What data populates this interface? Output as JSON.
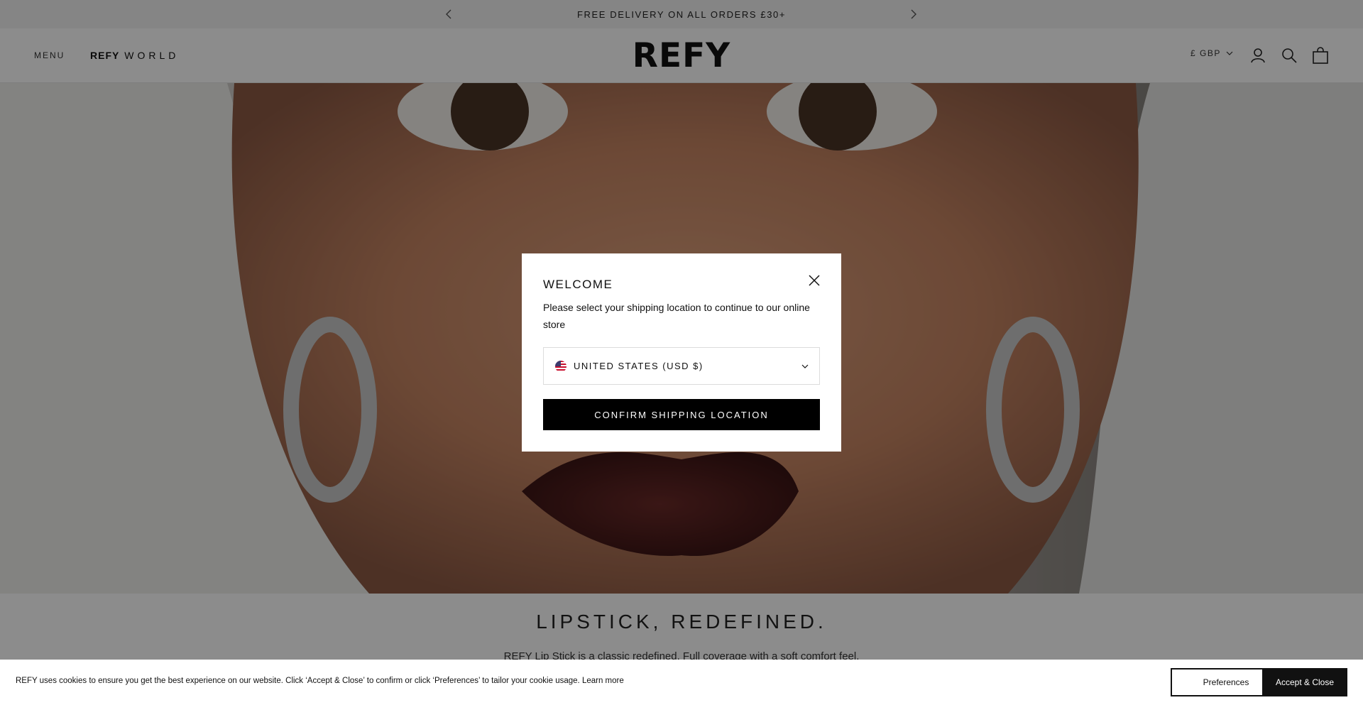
{
  "announcement": {
    "text": "FREE DELIVERY ON ALL ORDERS £30+"
  },
  "header": {
    "menu_label": "MENU",
    "world_brand": "REFY",
    "world_word": "WORLD",
    "logo": "REFY",
    "currency": "£ GBP"
  },
  "hero": {
    "title": "LIPSTICK, REDEFINED.",
    "subtitle": "REFY Lip Stick is a classic redefined. Full coverage with a soft comfort feel."
  },
  "modal": {
    "title": "WELCOME",
    "message": "Please select your shipping location to continue to our online store",
    "selected_location": "UNITED STATES (USD $)",
    "confirm_label": "CONFIRM SHIPPING LOCATION"
  },
  "cookie": {
    "message": "REFY uses cookies to ensure you get the best experience on our website. Click ‘Accept & Close’ to confirm or click ‘Preferences’ to tailor your cookie usage.",
    "learn_more": "Learn more",
    "preferences_label": "Preferences",
    "accept_label": "Accept & Close"
  },
  "colors": {
    "accent": "#000000",
    "overlay": "rgba(0,0,0,0.45)"
  }
}
